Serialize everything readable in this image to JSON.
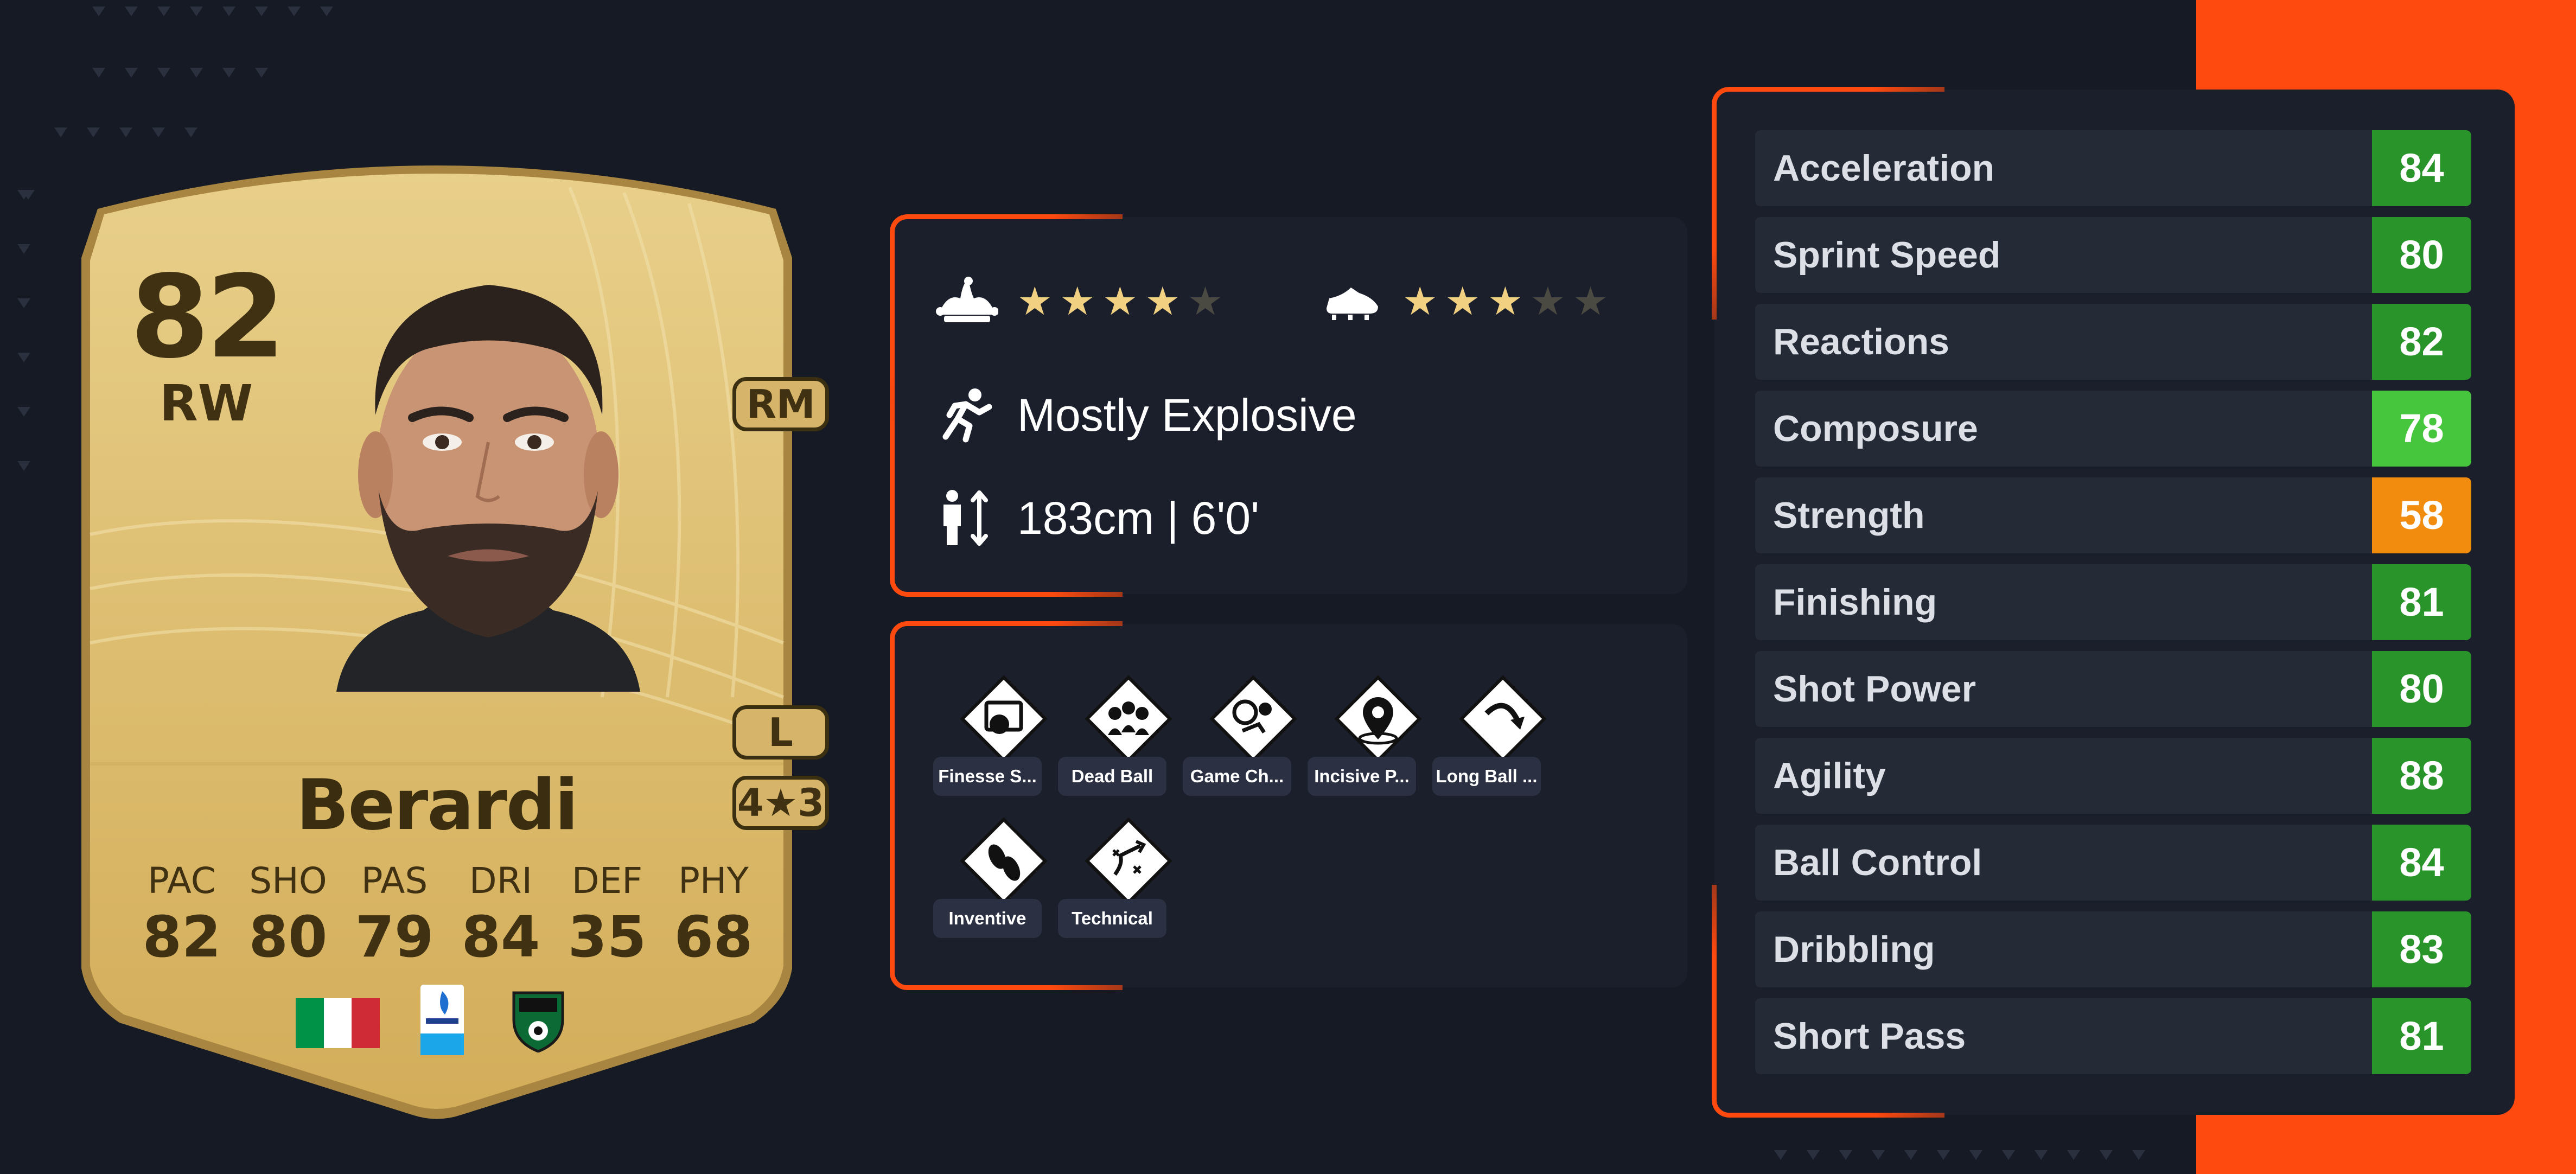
{
  "theme": {
    "accent": "#ff4a0f",
    "background": "#151a25",
    "panel": "#1b1f2b",
    "card_gold": "#e1c273",
    "stat_green_dark": "#28942a",
    "stat_green_light": "#46c63c",
    "stat_orange": "#f28c0f"
  },
  "card": {
    "rating": "82",
    "position": "RW",
    "alt_position": "RM",
    "preferred_foot": "L",
    "skill_badge": "4★3",
    "name": "Berardi",
    "stats": [
      {
        "label": "PAC",
        "value": "82"
      },
      {
        "label": "SHO",
        "value": "80"
      },
      {
        "label": "PAS",
        "value": "79"
      },
      {
        "label": "DRI",
        "value": "84"
      },
      {
        "label": "DEF",
        "value": "35"
      },
      {
        "label": "PHY",
        "value": "68"
      }
    ],
    "nation": {
      "icon": "italy-flag-icon",
      "colors": [
        "#009246",
        "#ffffff",
        "#ce2b37"
      ]
    },
    "league": {
      "icon": "serie-a-logo-icon"
    },
    "club": {
      "icon": "sassuolo-crest-icon"
    }
  },
  "traits": {
    "skill_moves": {
      "icon": "jester-hat-icon",
      "stars": 4,
      "max": 5
    },
    "weak_foot": {
      "icon": "boot-icon",
      "stars": 3,
      "max": 5
    },
    "accelerate_type": {
      "icon": "running-icon",
      "text": "Mostly Explosive"
    },
    "height": {
      "icon": "height-icon",
      "text": "183cm | 6'0'"
    }
  },
  "playstyles": [
    {
      "icon": "finesse-shot-icon",
      "label": "Finesse S..."
    },
    {
      "icon": "dead-ball-icon",
      "label": "Dead Ball"
    },
    {
      "icon": "game-changer-icon",
      "label": "Game Ch..."
    },
    {
      "icon": "incisive-pass-icon",
      "label": "Incisive P..."
    },
    {
      "icon": "long-ball-pass-icon",
      "label": "Long Ball ..."
    },
    {
      "icon": "inventive-icon",
      "label": "Inventive"
    },
    {
      "icon": "technical-icon",
      "label": "Technical"
    }
  ],
  "attributes": [
    {
      "name": "Acceleration",
      "value": "84",
      "color": "#28942a"
    },
    {
      "name": "Sprint Speed",
      "value": "80",
      "color": "#28942a"
    },
    {
      "name": "Reactions",
      "value": "82",
      "color": "#28942a"
    },
    {
      "name": "Composure",
      "value": "78",
      "color": "#46c63c"
    },
    {
      "name": "Strength",
      "value": "58",
      "color": "#f28c0f"
    },
    {
      "name": "Finishing",
      "value": "81",
      "color": "#28942a"
    },
    {
      "name": "Shot Power",
      "value": "80",
      "color": "#28942a"
    },
    {
      "name": "Agility",
      "value": "88",
      "color": "#28942a"
    },
    {
      "name": "Ball Control",
      "value": "84",
      "color": "#28942a"
    },
    {
      "name": "Dribbling",
      "value": "83",
      "color": "#28942a"
    },
    {
      "name": "Short Pass",
      "value": "81",
      "color": "#28942a"
    }
  ]
}
